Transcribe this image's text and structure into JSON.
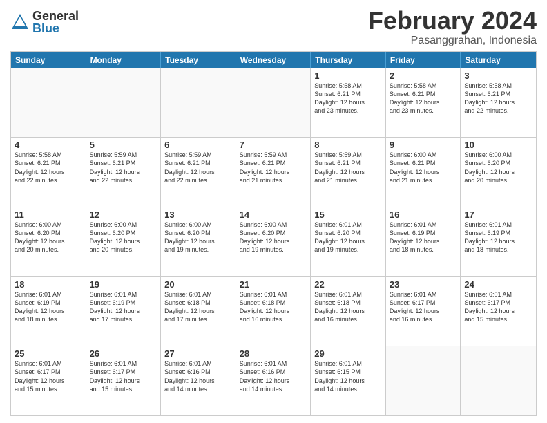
{
  "header": {
    "logo_general": "General",
    "logo_blue": "Blue",
    "month_title": "February 2024",
    "location": "Pasanggrahan, Indonesia"
  },
  "calendar": {
    "days": [
      "Sunday",
      "Monday",
      "Tuesday",
      "Wednesday",
      "Thursday",
      "Friday",
      "Saturday"
    ],
    "rows": [
      [
        {
          "num": "",
          "info": ""
        },
        {
          "num": "",
          "info": ""
        },
        {
          "num": "",
          "info": ""
        },
        {
          "num": "",
          "info": ""
        },
        {
          "num": "1",
          "info": "Sunrise: 5:58 AM\nSunset: 6:21 PM\nDaylight: 12 hours\nand 23 minutes."
        },
        {
          "num": "2",
          "info": "Sunrise: 5:58 AM\nSunset: 6:21 PM\nDaylight: 12 hours\nand 23 minutes."
        },
        {
          "num": "3",
          "info": "Sunrise: 5:58 AM\nSunset: 6:21 PM\nDaylight: 12 hours\nand 22 minutes."
        }
      ],
      [
        {
          "num": "4",
          "info": "Sunrise: 5:58 AM\nSunset: 6:21 PM\nDaylight: 12 hours\nand 22 minutes."
        },
        {
          "num": "5",
          "info": "Sunrise: 5:59 AM\nSunset: 6:21 PM\nDaylight: 12 hours\nand 22 minutes."
        },
        {
          "num": "6",
          "info": "Sunrise: 5:59 AM\nSunset: 6:21 PM\nDaylight: 12 hours\nand 22 minutes."
        },
        {
          "num": "7",
          "info": "Sunrise: 5:59 AM\nSunset: 6:21 PM\nDaylight: 12 hours\nand 21 minutes."
        },
        {
          "num": "8",
          "info": "Sunrise: 5:59 AM\nSunset: 6:21 PM\nDaylight: 12 hours\nand 21 minutes."
        },
        {
          "num": "9",
          "info": "Sunrise: 6:00 AM\nSunset: 6:21 PM\nDaylight: 12 hours\nand 21 minutes."
        },
        {
          "num": "10",
          "info": "Sunrise: 6:00 AM\nSunset: 6:20 PM\nDaylight: 12 hours\nand 20 minutes."
        }
      ],
      [
        {
          "num": "11",
          "info": "Sunrise: 6:00 AM\nSunset: 6:20 PM\nDaylight: 12 hours\nand 20 minutes."
        },
        {
          "num": "12",
          "info": "Sunrise: 6:00 AM\nSunset: 6:20 PM\nDaylight: 12 hours\nand 20 minutes."
        },
        {
          "num": "13",
          "info": "Sunrise: 6:00 AM\nSunset: 6:20 PM\nDaylight: 12 hours\nand 19 minutes."
        },
        {
          "num": "14",
          "info": "Sunrise: 6:00 AM\nSunset: 6:20 PM\nDaylight: 12 hours\nand 19 minutes."
        },
        {
          "num": "15",
          "info": "Sunrise: 6:01 AM\nSunset: 6:20 PM\nDaylight: 12 hours\nand 19 minutes."
        },
        {
          "num": "16",
          "info": "Sunrise: 6:01 AM\nSunset: 6:19 PM\nDaylight: 12 hours\nand 18 minutes."
        },
        {
          "num": "17",
          "info": "Sunrise: 6:01 AM\nSunset: 6:19 PM\nDaylight: 12 hours\nand 18 minutes."
        }
      ],
      [
        {
          "num": "18",
          "info": "Sunrise: 6:01 AM\nSunset: 6:19 PM\nDaylight: 12 hours\nand 18 minutes."
        },
        {
          "num": "19",
          "info": "Sunrise: 6:01 AM\nSunset: 6:19 PM\nDaylight: 12 hours\nand 17 minutes."
        },
        {
          "num": "20",
          "info": "Sunrise: 6:01 AM\nSunset: 6:18 PM\nDaylight: 12 hours\nand 17 minutes."
        },
        {
          "num": "21",
          "info": "Sunrise: 6:01 AM\nSunset: 6:18 PM\nDaylight: 12 hours\nand 16 minutes."
        },
        {
          "num": "22",
          "info": "Sunrise: 6:01 AM\nSunset: 6:18 PM\nDaylight: 12 hours\nand 16 minutes."
        },
        {
          "num": "23",
          "info": "Sunrise: 6:01 AM\nSunset: 6:17 PM\nDaylight: 12 hours\nand 16 minutes."
        },
        {
          "num": "24",
          "info": "Sunrise: 6:01 AM\nSunset: 6:17 PM\nDaylight: 12 hours\nand 15 minutes."
        }
      ],
      [
        {
          "num": "25",
          "info": "Sunrise: 6:01 AM\nSunset: 6:17 PM\nDaylight: 12 hours\nand 15 minutes."
        },
        {
          "num": "26",
          "info": "Sunrise: 6:01 AM\nSunset: 6:17 PM\nDaylight: 12 hours\nand 15 minutes."
        },
        {
          "num": "27",
          "info": "Sunrise: 6:01 AM\nSunset: 6:16 PM\nDaylight: 12 hours\nand 14 minutes."
        },
        {
          "num": "28",
          "info": "Sunrise: 6:01 AM\nSunset: 6:16 PM\nDaylight: 12 hours\nand 14 minutes."
        },
        {
          "num": "29",
          "info": "Sunrise: 6:01 AM\nSunset: 6:15 PM\nDaylight: 12 hours\nand 14 minutes."
        },
        {
          "num": "",
          "info": ""
        },
        {
          "num": "",
          "info": ""
        }
      ]
    ]
  }
}
